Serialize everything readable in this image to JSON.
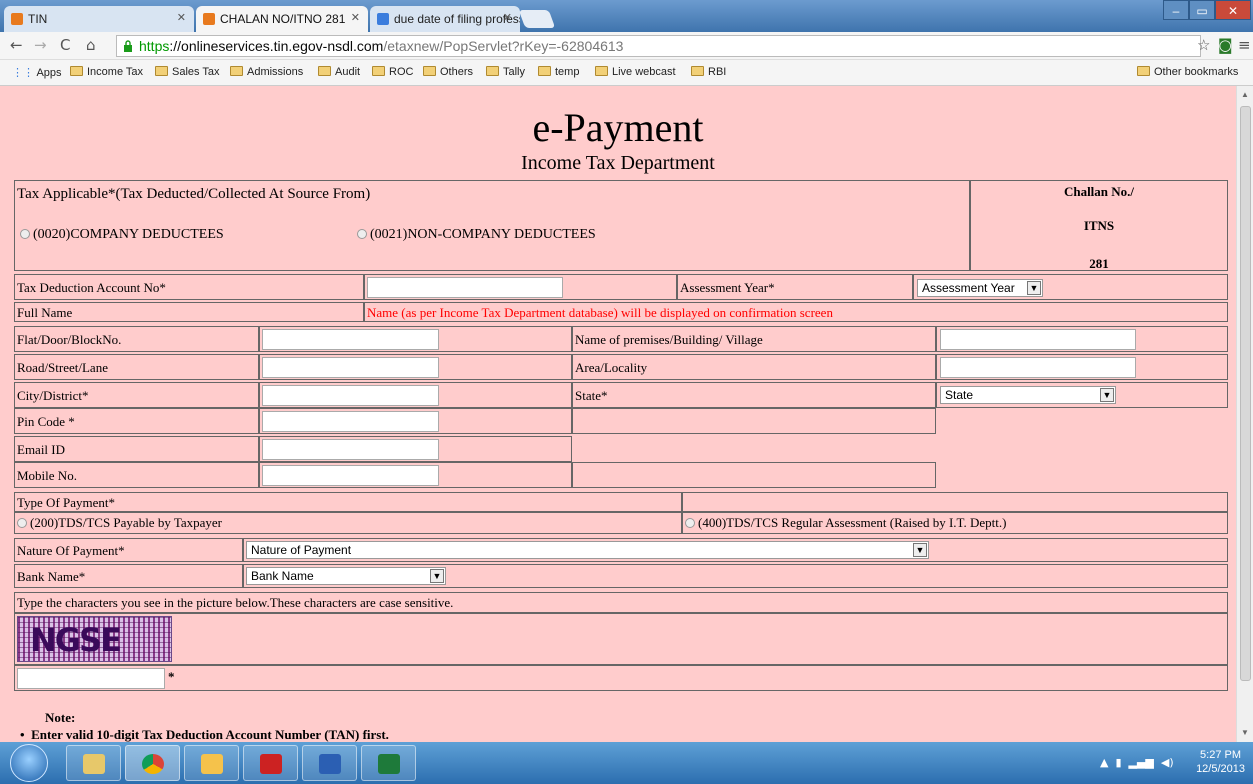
{
  "browser": {
    "tabs": [
      {
        "label": "TIN",
        "icon": "tin-favicon-icon"
      },
      {
        "label": "CHALAN NO/ITNO 281",
        "icon": "tin-favicon-icon"
      },
      {
        "label": "due date of filing professi",
        "icon": "google-favicon-icon"
      }
    ],
    "url_scheme": "https",
    "url_host": "://onlineservices.tin.egov-nsdl.com",
    "url_path": "/etaxnew/PopServlet?rKey=-62804613",
    "bookmarks": [
      "Apps",
      "Income Tax",
      "Sales Tax",
      "Admissions",
      "Audit",
      "ROC",
      "Others",
      "Tally",
      "temp",
      "Live webcast",
      "RBI"
    ],
    "other_bookmarks": "Other bookmarks"
  },
  "page": {
    "title": "e-Payment",
    "subtitle": "Income Tax Department",
    "tax_applicable_label": "Tax Applicable*(Tax Deducted/Collected At Source From)",
    "radio_company": "(0020)COMPANY DEDUCTEES",
    "radio_noncompany": "(0021)NON-COMPANY DEDUCTEES",
    "challan_label": "Challan No./",
    "itns_label": "ITNS",
    "itns_number": "281",
    "tan_label": "Tax Deduction Account No*",
    "assessment_year_label": "Assessment Year*",
    "assessment_year_select": "Assessment Year",
    "full_name_label": "Full Name",
    "full_name_note": "Name (as per Income Tax Department database) will be displayed on confirmation screen",
    "flat_label": "Flat/Door/BlockNo.",
    "premises_label": "Name of premises/Building/ Village",
    "road_label": "Road/Street/Lane",
    "area_label": "Area/Locality",
    "city_label": "City/District*",
    "state_label": "State*",
    "state_select": "State",
    "pin_label": "Pin Code *",
    "email_label": "Email ID",
    "mobile_label": "Mobile No.",
    "payment_type_label": "Type Of Payment*",
    "payment_200": "(200)TDS/TCS Payable by Taxpayer",
    "payment_400": "(400)TDS/TCS Regular Assessment (Raised by I.T. Deptt.)",
    "nature_label": "Nature Of Payment*",
    "nature_select": "Nature of Payment",
    "bank_label": "Bank Name*",
    "bank_select": "Bank Name",
    "captcha_instruction": "Type the characters you see in the picture below.These characters are case sensitive.",
    "captcha_text": "NGSE",
    "captcha_required_mark": "*",
    "note_title": "Note:",
    "note_item": "Enter valid 10-digit Tax Deduction Account Number (TAN) first."
  },
  "taskbar": {
    "time": "5:27 PM",
    "date": "12/5/2013"
  }
}
